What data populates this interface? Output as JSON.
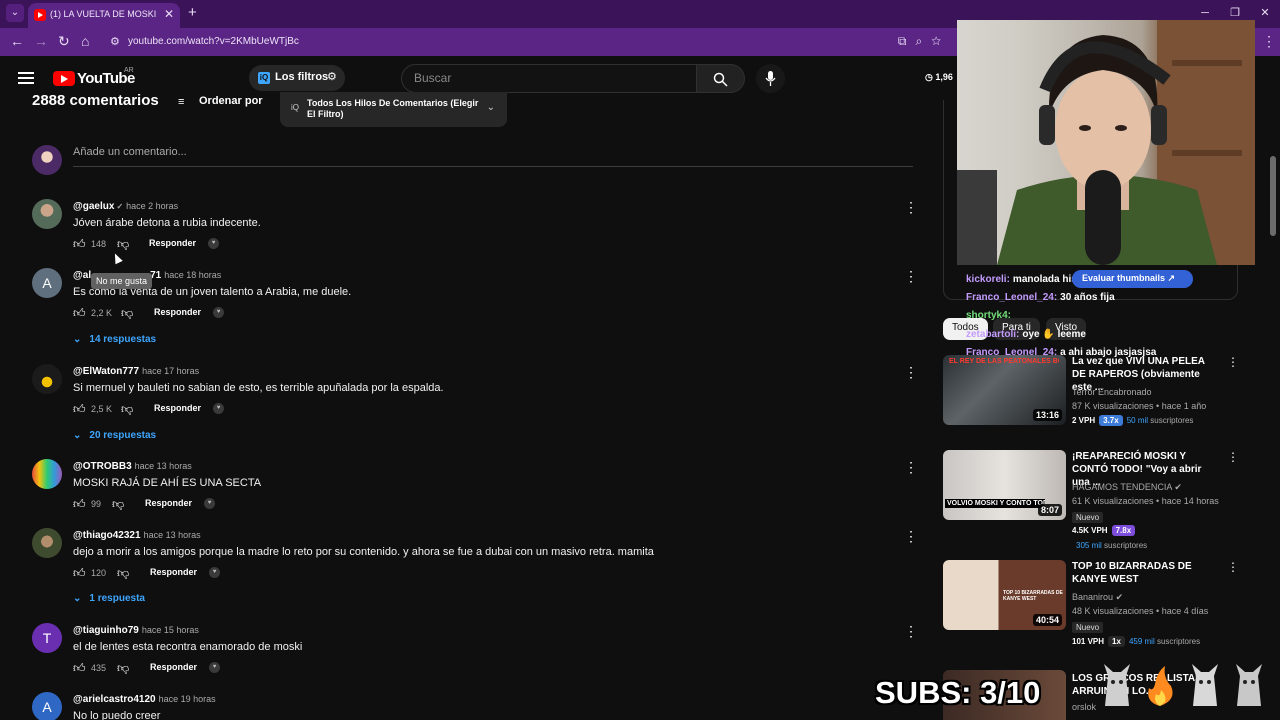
{
  "browser": {
    "tab_title": "(1) LA VUELTA DE MOSKI Y UN",
    "url": "youtube.com/watch?v=2KMbUeWTjBc",
    "accent": "#5a2585"
  },
  "header": {
    "logo_text": "YouTube",
    "country": "AR",
    "filters_label": "Los filtros",
    "search_placeholder": "Buscar",
    "watch_time": "1,96"
  },
  "comments": {
    "count_label": "2888 comentarios",
    "sort_label": "Ordenar por",
    "thread_filter": "Todos Los Hilos De Comentarios (Elegir El Filtro)",
    "add_placeholder": "Añade un comentario...",
    "tooltip": "No me gusta",
    "items": [
      {
        "author": "@gaelux",
        "verified": "✓",
        "time": "hace 2 horas",
        "text": "Jóven árabe detona a rubia indecente.",
        "likes": "148",
        "reply_label": "Responder"
      },
      {
        "author": "@al",
        "author_tail": "71",
        "time": "hace 18 horas",
        "text": "Es como la venta de un joven talento a Arabia, me duele.",
        "likes": "2,2 K",
        "reply_label": "Responder",
        "replies": "14 respuestas",
        "avatar_letter": "A"
      },
      {
        "author": "@ElWaton777",
        "time": "hace 17 horas",
        "text": "Si mernuel y bauleti no sabian de esto, es terrible apuñalada por la espalda.",
        "likes": "2,5 K",
        "reply_label": "Responder",
        "replies": "20 respuestas"
      },
      {
        "author": "@OTROBB3",
        "time": "hace 13 horas",
        "text": "MOSKI RAJÁ DE AHÍ ES UNA SECTA",
        "likes": "99",
        "reply_label": "Responder"
      },
      {
        "author": "@thiago42321",
        "time": "hace 13 horas",
        "text": "dejo a morir a los amigos porque la madre lo reto por su contenido. y ahora se fue a dubai con un masivo retra. mamita",
        "likes": "120",
        "reply_label": "Responder",
        "replies": "1 respuesta"
      },
      {
        "author": "@tiaguinho79",
        "time": "hace 15 horas",
        "text": "el de lentes esta recontra enamorado de moski",
        "likes": "435",
        "reply_label": "Responder",
        "avatar_letter": "T"
      },
      {
        "author": "@arielcastro4120",
        "time": "hace 19 horas",
        "text": "No lo puedo creer",
        "avatar_letter": "A"
      }
    ]
  },
  "chat": [
    {
      "user": "kickoreli:",
      "msg": "manolada historica mal"
    },
    {
      "user": "Franco_Leonel_24:",
      "msg": "30 años fija"
    },
    {
      "user": "shortyk4:",
      "msg": ""
    },
    {
      "user": "zetabartoli:",
      "msg": "oye ✋ leeme"
    },
    {
      "user": "Franco_Leonel_24:",
      "msg": "a ahi abajo jasjasjsa"
    }
  ],
  "sidebar": {
    "thumbnails_button": "Evaluar thumbnails ↗",
    "chips": [
      "Todos",
      "Para ti",
      "Visto"
    ],
    "videos": [
      {
        "title": "La vez que VIVI UNA PELEA DE RAPEROS (obviamente este ...",
        "channel": "Terror Encabronado",
        "meta": "87 K visualizaciones • hace 1 año",
        "duration": "13:16",
        "vph": "2 VPH",
        "ratio": "3.7x",
        "ratio_color": "#3d7bd9",
        "subs_value": "50 mil",
        "subs_label": "suscriptores",
        "thumb_text": "EL REY DE LAS PEATONALES BOOM"
      },
      {
        "title": "¡REAPARECIÓ MOSKI Y CONTÓ TODO! \"Voy a abrir una ...",
        "channel": "HAGAMOS TENDENCIA",
        "meta": "61 K visualizaciones • hace 14 horas",
        "duration": "8:07",
        "badge": "Nuevo",
        "vph": "4.5K VPH",
        "ratio": "7.8x",
        "ratio_color": "#7c4ddb",
        "subs_value": "305 mil",
        "subs_label": "suscriptores",
        "thumb_text": "VOLVIÓ MOSKI Y CONTÓ TODO"
      },
      {
        "title": "TOP 10 BIZARRADAS DE KANYE WEST",
        "channel": "Bananirou",
        "meta": "48 K visualizaciones • hace 4 días",
        "duration": "40:54",
        "badge": "Nuevo",
        "vph": "101 VPH",
        "ratio": "1x",
        "ratio_color": "#272727",
        "subs_value": "459 mil",
        "subs_label": "suscriptores",
        "thumb_text": "TOP 10 BIZARRADAS DE KANYE WEST"
      },
      {
        "title": "LOS GR... COS REALISTAS ARRUIN... N LO...",
        "channel": "orslok"
      }
    ]
  },
  "overlay": {
    "subs": "SUBS: 3/10"
  }
}
